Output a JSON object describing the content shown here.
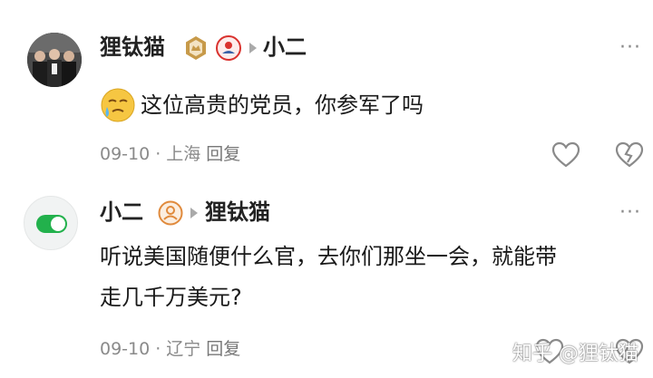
{
  "comments": [
    {
      "author": "狸钛猫",
      "reply_to": "小二",
      "text": "这位高贵的党员，你参军了吗",
      "date": "09-10",
      "location": "上海",
      "reply_label": "回复",
      "more_label": "···",
      "emoji": "weary-sweat-face"
    },
    {
      "author": "小二",
      "reply_to": "狸钛猫",
      "text_line1": "听说美国随便什么官，去你们那坐一会，就能带",
      "text_line2": "走几千万美元?",
      "date": "09-10",
      "location": "辽宁",
      "reply_label": "回复",
      "more_label": "···"
    }
  ],
  "watermark": "知乎 @狸钛猫",
  "colors": {
    "toggle": "#22b14c",
    "badge_gold": "#c79a4a",
    "badge_red": "#d9322e",
    "meta": "#8a8a8a"
  }
}
